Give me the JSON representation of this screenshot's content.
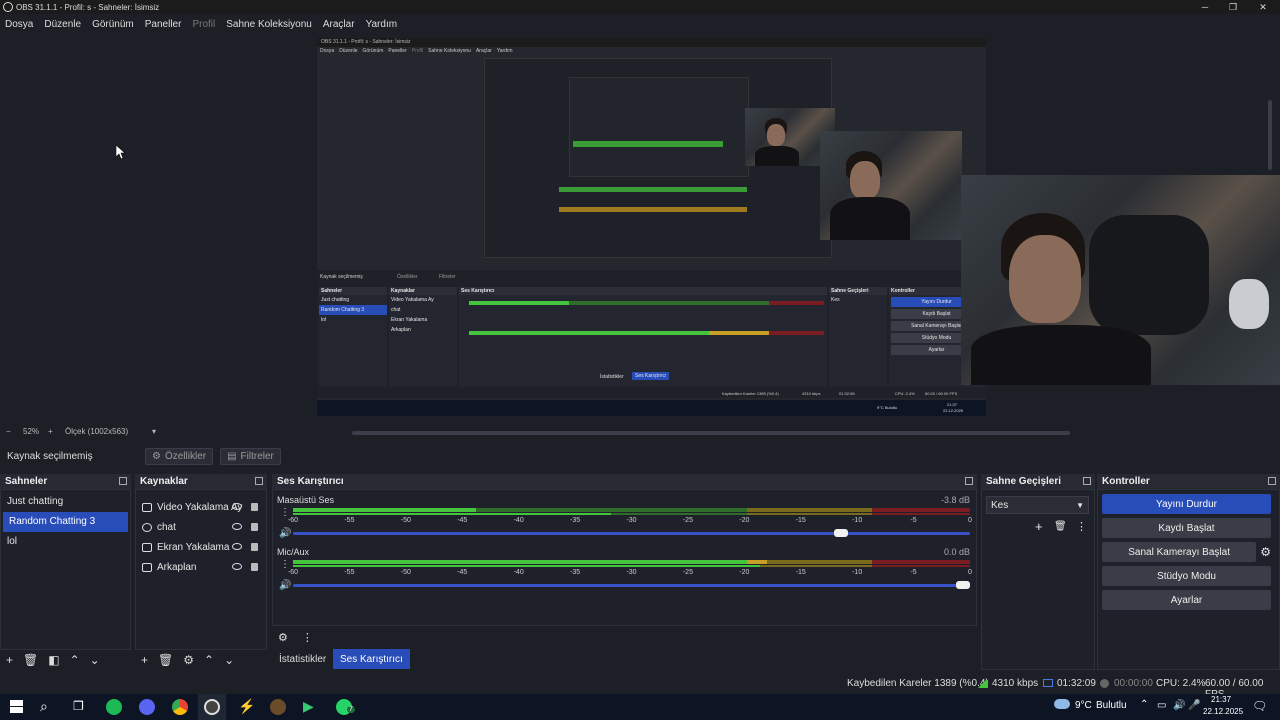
{
  "window": {
    "title": "OBS 31.1.1 - Profil: s - Sahneler: İsimsiz"
  },
  "menu": {
    "items": [
      "Dosya",
      "Düzenle",
      "Görünüm",
      "Paneller",
      "Profil",
      "Sahne Koleksiyonu",
      "Araçlar",
      "Yardım"
    ]
  },
  "preview": {
    "mini_title": "OBS 31.1.1 - Profil: s - Sahneler: İsimsiz",
    "mini_menu": [
      "Dosya",
      "Düzenle",
      "Görünüm",
      "Paneller",
      "Profil",
      "Sahne Koleksiyonu",
      "Araçlar",
      "Yardım"
    ],
    "mini_no_source": "Kaynak seçilmemiş",
    "mini_props": "Özellikler",
    "mini_filters": "Filtreler",
    "mini_scenes_title": "Sahneler",
    "mini_sources_title": "Kaynaklar",
    "mini_mixer_title": "Ses Karıştırıcı",
    "mini_transitions_title": "Sahne Geçişleri",
    "mini_controls_title": "Kontroller",
    "mini_scenes": [
      "Just chatting",
      "Random Chatting 3",
      "lol"
    ],
    "mini_sources": [
      "Video Yakalama Ay",
      "chat",
      "Ekran Yakalama",
      "Arkaplan"
    ],
    "mini_ctrls": [
      "Yayını Durdur",
      "Kaydı Başlat",
      "Sanal Kamerayı Başlat",
      "Stüdyo Modu",
      "Ayarlar"
    ],
    "mini_transition": "Kes",
    "mini_status": "Kaybedilen Kareler 1389 (%0.4)",
    "mini_kbps": "4310 kbps",
    "mini_time": "01:32:08",
    "mini_cpu": "CPU: 2.4%",
    "mini_fps": "60.00 / 60.00 FPS",
    "mini_tabs": [
      "İstatistikler",
      "Ses Karıştırıcı"
    ],
    "mini_weather": "9°C Bulutlu",
    "mini_clock": "21:37",
    "mini_date": "22.12.2025"
  },
  "zoom": {
    "percent": "52%",
    "scale": "Ölçek (1002x563)"
  },
  "source_toolbar": {
    "no_source": "Kaynak seçilmemiş",
    "properties": "Özellikler",
    "filters": "Filtreler"
  },
  "scenes": {
    "title": "Sahneler",
    "items": [
      "Just chatting",
      "Random Chatting 3",
      "lol"
    ],
    "selected_index": 1
  },
  "sources": {
    "title": "Kaynaklar",
    "items": [
      {
        "label": "Video Yakalama Ay",
        "icon": "camera-icon"
      },
      {
        "label": "chat",
        "icon": "globe-icon"
      },
      {
        "label": "Ekran Yakalama",
        "icon": "monitor-icon"
      },
      {
        "label": "Arkaplan",
        "icon": "image-icon"
      }
    ]
  },
  "mixer": {
    "title": "Ses Karıştırıcı",
    "ticks": [
      "-60",
      "-55",
      "-50",
      "-45",
      "-40",
      "-35",
      "-30",
      "-25",
      "-20",
      "-15",
      "-10",
      "-5",
      "0"
    ],
    "channels": [
      {
        "name": "Masaüstü Ses",
        "db": "-3.8 dB",
        "level": 0.27,
        "volume": 0.82
      },
      {
        "name": "Mic/Aux",
        "db": "0.0 dB",
        "level": 0.69,
        "volume": 1.0
      }
    ]
  },
  "transitions": {
    "title": "Sahne Geçişleri",
    "selected": "Kes"
  },
  "controls": {
    "title": "Kontroller",
    "buttons": [
      "Yayını Durdur",
      "Kaydı Başlat",
      "Sanal Kamerayı Başlat",
      "Stüdyo Modu",
      "Ayarlar"
    ]
  },
  "tabs": {
    "stats": "İstatistikler",
    "mixer": "Ses Karıştırıcı"
  },
  "status": {
    "dropped": "Kaybedilen Kareler 1389 (%0.4)",
    "kbps": "4310 kbps",
    "stream_time": "01:32:09",
    "rec_time": "00:00:00",
    "cpu": "CPU: 2.4%",
    "fps": "60.00 / 60.00 FPS"
  },
  "taskbar": {
    "weather": "9°C",
    "weather_desc": "Bulutlu",
    "time": "21:37",
    "date": "22.12.2025",
    "wa_badge": "7"
  },
  "colors": {
    "accent": "#284cb8",
    "meter_green": "#45c43d",
    "meter_yellow": "#c8a024",
    "meter_red": "#c4262e"
  }
}
